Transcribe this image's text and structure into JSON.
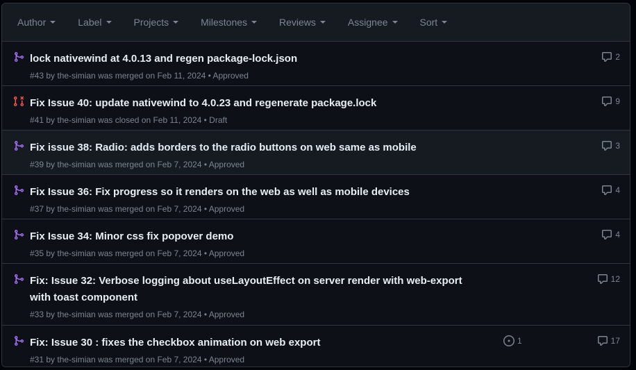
{
  "toolbar": {
    "filters": [
      {
        "label": "Author"
      },
      {
        "label": "Label"
      },
      {
        "label": "Projects"
      },
      {
        "label": "Milestones"
      },
      {
        "label": "Reviews"
      },
      {
        "label": "Assignee"
      },
      {
        "label": "Sort"
      }
    ]
  },
  "colors": {
    "merged": "#a371f7",
    "closed": "#f85149",
    "muted": "#7d8590",
    "title": "#e6edf3"
  },
  "pulls": [
    {
      "title": "lock nativewind at 4.0.13 and regen package-lock.json",
      "number": "#43",
      "by": " by ",
      "author": "the-simian",
      "action": " was ",
      "state_word": "merged",
      "on": " on ",
      "date": "Feb 11, 2024",
      "review": " • Approved",
      "comments": "2",
      "state": "merged"
    },
    {
      "title": "Fix Issue 40: update nativewind to 4.0.23 and regenerate package.lock",
      "number": "#41",
      "by": " by ",
      "author": "the-simian",
      "action": " was ",
      "state_word": "closed",
      "on": " on ",
      "date": "Feb 11, 2024",
      "review": " • Draft",
      "comments": "9",
      "state": "closed"
    },
    {
      "title": "Fix issue 38: Radio: adds borders to the radio buttons on web same as mobile",
      "number": "#39",
      "by": " by ",
      "author": "the-simian",
      "action": " was ",
      "state_word": "merged",
      "on": " on ",
      "date": "Feb 7, 2024",
      "review": " • Approved",
      "comments": "3",
      "state": "merged"
    },
    {
      "title": "Fix Issue 36: Fix progress so it renders on the web as well as mobile devices",
      "number": "#37",
      "by": " by ",
      "author": "the-simian",
      "action": " was ",
      "state_word": "merged",
      "on": " on ",
      "date": "Feb 7, 2024",
      "review": " • Approved",
      "comments": "4",
      "state": "merged"
    },
    {
      "title": "Fix Issue 34: Minor css fix popover demo",
      "number": "#35",
      "by": " by ",
      "author": "the-simian",
      "action": " was ",
      "state_word": "merged",
      "on": " on ",
      "date": "Feb 7, 2024",
      "review": " • Approved",
      "comments": "4",
      "state": "merged"
    },
    {
      "title": "Fix: Issue 32: Verbose logging about useLayoutEffect on server render with web-export with toast component",
      "number": "#33",
      "by": " by ",
      "author": "the-simian",
      "action": " was ",
      "state_word": "merged",
      "on": " on ",
      "date": "Feb 7, 2024",
      "review": " • Approved",
      "comments": "12",
      "state": "merged"
    },
    {
      "title": "Fix: Issue 30 : fixes the checkbox animation on web export",
      "number": "#31",
      "by": " by ",
      "author": "the-simian",
      "action": " was ",
      "state_word": "merged",
      "on": " on ",
      "date": "Feb 7, 2024",
      "review": " • Approved",
      "comments": "17",
      "linked_issues": "1",
      "state": "merged"
    }
  ]
}
